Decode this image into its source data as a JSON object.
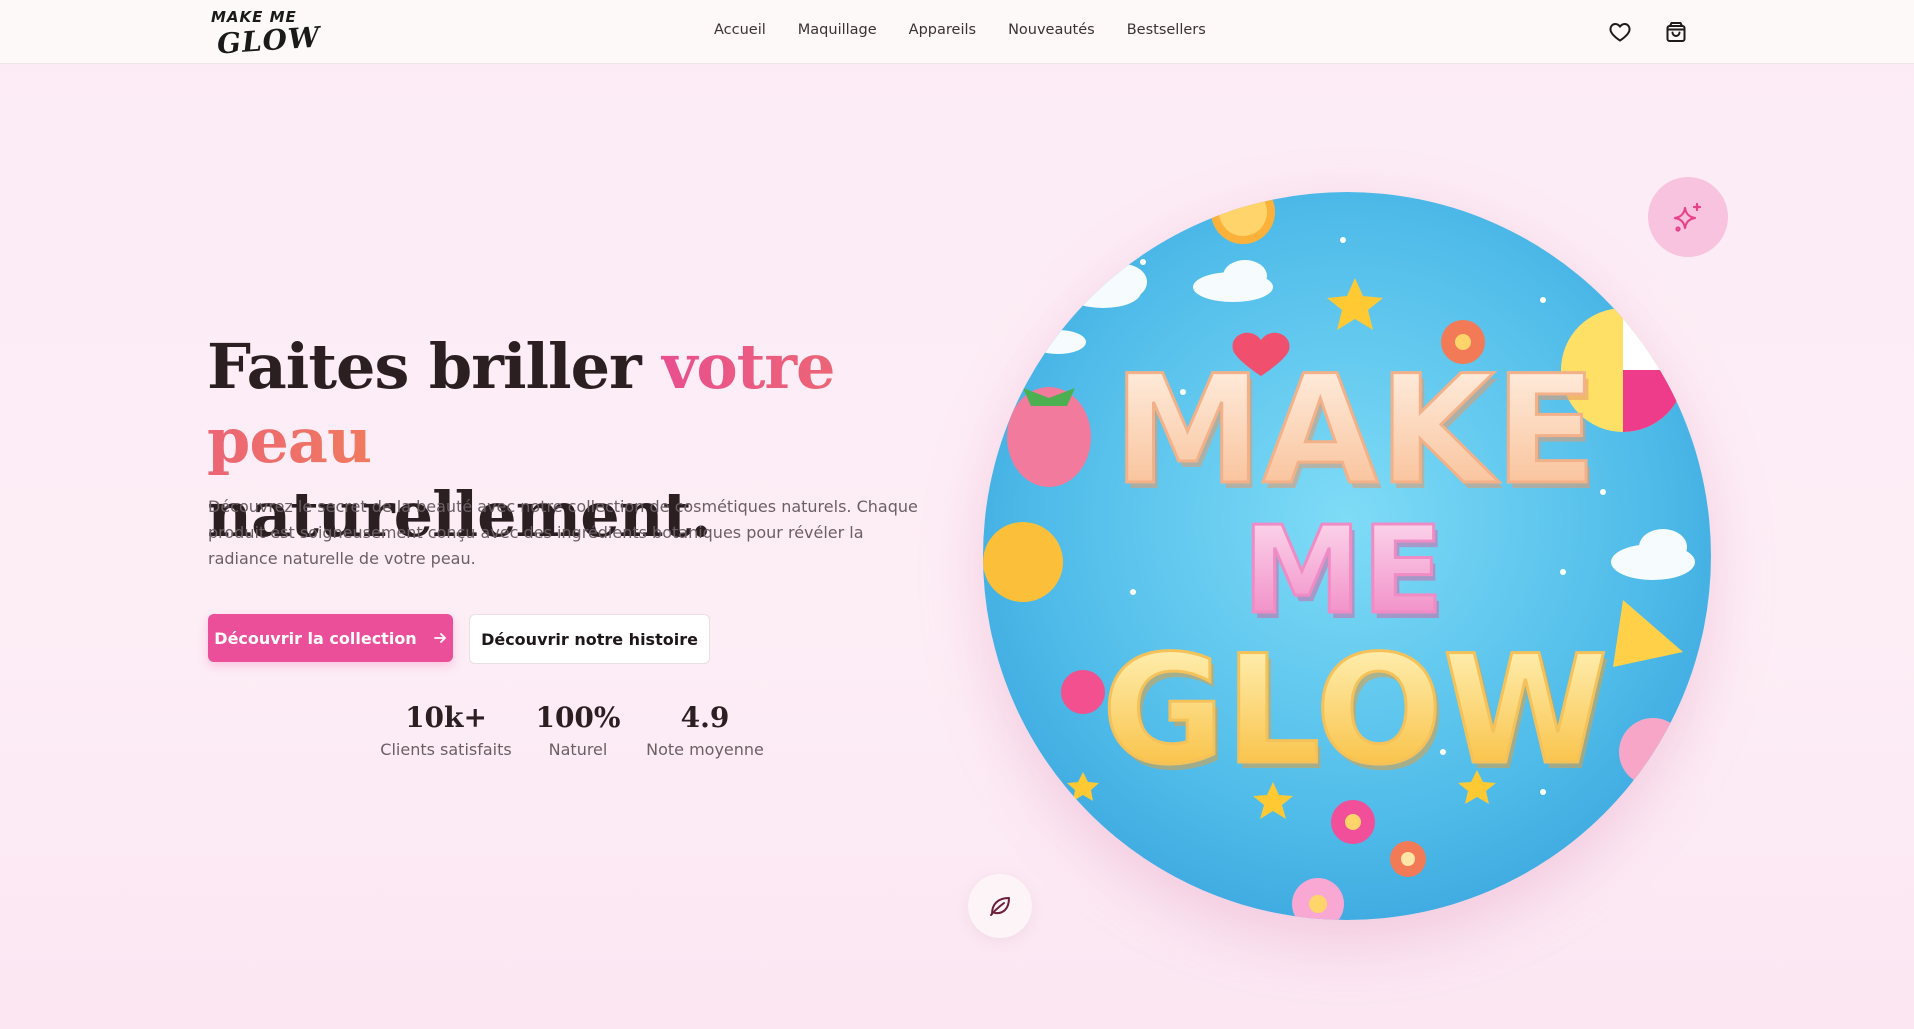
{
  "header": {
    "logo_line1": "MAKE ME",
    "logo_line2": "GLOW",
    "nav": [
      "Accueil",
      "Maquillage",
      "Appareils",
      "Nouveautés",
      "Bestsellers"
    ],
    "icons": [
      "heart-icon",
      "shopping-bag-icon"
    ]
  },
  "hero": {
    "title_part1": "Faites briller ",
    "title_accent": "votre peau",
    "title_part2": "naturellement.",
    "description": "Découvrez le secret de la beauté avec notre collection de cosmétiques naturels. Chaque produit est soigneusement conçu avec des ingrédients botaniques pour révéler la radiance naturelle de votre peau.",
    "primary_button": "Découvrir la collection",
    "secondary_button": "Découvrir notre histoire",
    "stats": [
      {
        "value": "10k+",
        "label": "Clients satisfaits"
      },
      {
        "value": "100%",
        "label": "Naturel"
      },
      {
        "value": "4.9",
        "label": "Note moyenne"
      }
    ]
  },
  "artwork": {
    "line1": "MAKE",
    "line2": "ME",
    "line3": "GLOW"
  },
  "colors": {
    "accent_pink": "#eb4f9a",
    "accent_coral": "#f07a5e",
    "sky_blue": "#5cc8f0",
    "background": "#fcebf5"
  }
}
